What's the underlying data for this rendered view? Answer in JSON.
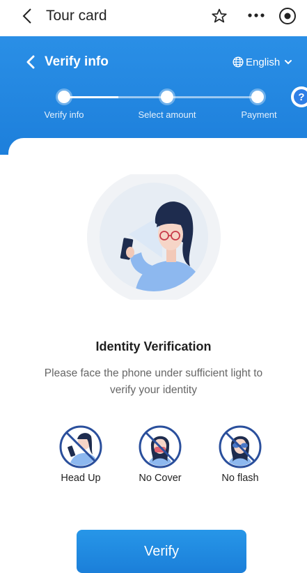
{
  "topbar": {
    "title": "Tour card",
    "back_icon": "chevron-left-icon",
    "favorite_icon": "star-outline-icon",
    "more_icon": "more-dots-icon",
    "target_icon": "record-target-icon"
  },
  "header": {
    "title": "Verify info",
    "language": "English",
    "help": "?",
    "background": "#1f84de"
  },
  "steps": [
    {
      "label": "Verify info",
      "state": "current"
    },
    {
      "label": "Select amount",
      "state": "pending"
    },
    {
      "label": "Payment",
      "state": "pending"
    }
  ],
  "main": {
    "headline": "Identity Verification",
    "description": "Please face the phone under sufficient light to verify your identity"
  },
  "tips": [
    {
      "label": "Head Up",
      "icon": "no-head-down-icon"
    },
    {
      "label": "No Cover",
      "icon": "no-face-cover-icon"
    },
    {
      "label": "No flash",
      "icon": "no-flash-glasses-icon"
    }
  ],
  "actions": {
    "verify_label": "Verify"
  },
  "colors": {
    "accent": "#1f84de",
    "prohibit": "#2a4f9c"
  }
}
